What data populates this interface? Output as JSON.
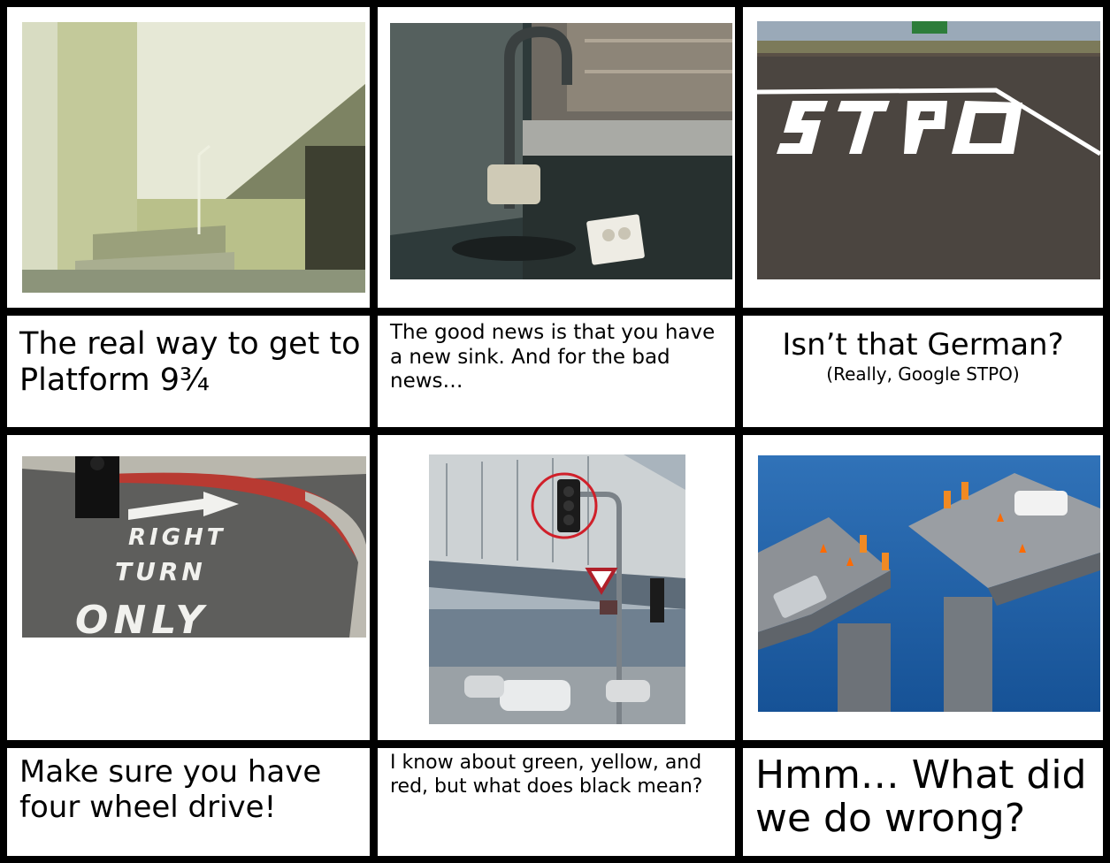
{
  "panels": [
    {
      "id": "platform",
      "photo": "stairwell-photo",
      "caption": "The real way to get to Platform 9¾"
    },
    {
      "id": "sink",
      "photo": "faucet-over-outlet-photo",
      "caption": "The good news is that you have a new sink.  And for the bad news…"
    },
    {
      "id": "stpo",
      "photo": "misspelled-stop-road-photo",
      "caption": "Isn’t that German?",
      "subcaption": "(Really, Google STPO)"
    },
    {
      "id": "rightturn",
      "photo": "right-turn-only-road-photo",
      "caption": "Make sure you have four wheel drive!",
      "road_text": [
        "RIGHT",
        "TURN",
        "ONLY"
      ]
    },
    {
      "id": "blacklight",
      "photo": "black-traffic-light-photo",
      "caption": "I know about green, yellow, and red, but what does black mean?"
    },
    {
      "id": "bridge",
      "photo": "misaligned-bridge-photo",
      "caption": "Hmm… What did we do wrong?"
    }
  ],
  "colors": {
    "border": "#000000",
    "road_marking": "#ffffff",
    "curb_red": "#c0392b",
    "sea": "#1d5fa8",
    "highlight_circle": "#d0202a"
  }
}
